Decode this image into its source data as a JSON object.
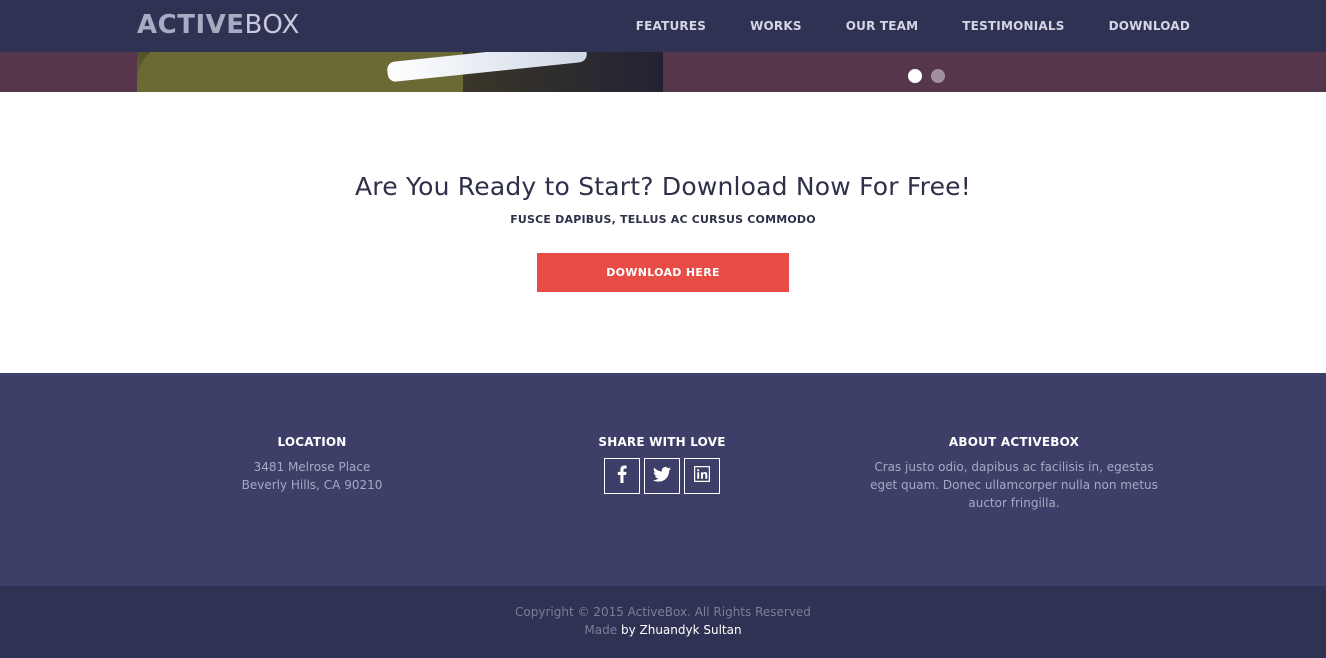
{
  "nav": {
    "logo_bold": "ACTIVE",
    "logo_light": "BOX",
    "links": [
      "FEATURES",
      "WORKS",
      "OUR TEAM",
      "TESTIMONIALS",
      "DOWNLOAD"
    ]
  },
  "slider": {
    "dots": 2,
    "active_dot": 0
  },
  "cta": {
    "title": "Are You Ready to Start? Download Now For Free!",
    "subtitle": "FUSCE DAPIBUS, TELLUS AC CURSUS COMMODO",
    "button_label": "DOWNLOAD HERE",
    "button_color": "#e74c46"
  },
  "footer": {
    "location": {
      "title": "LOCATION",
      "line1": "3481 Melrose Place",
      "line2": "Beverly Hills, CA 90210"
    },
    "share": {
      "title": "SHARE WITH LOVE",
      "icons": [
        "facebook-icon",
        "twitter-icon",
        "linkedin-icon"
      ]
    },
    "about": {
      "title": "ABOUT ACTIVEBOX",
      "text": "Cras justo odio, dapibus ac facilisis in, egestas eget quam. Donec ullamcorper nulla non metus auctor fringilla."
    },
    "copyright": "Copyright © 2015 ActiveBox. All Rights Reserved",
    "made_prefix": "Made",
    "made_by": "by Zhuandyk Sultan"
  },
  "colors": {
    "nav_bg": "#2f3252",
    "footer_bg": "#3d3f69",
    "accent": "#e74c46"
  }
}
